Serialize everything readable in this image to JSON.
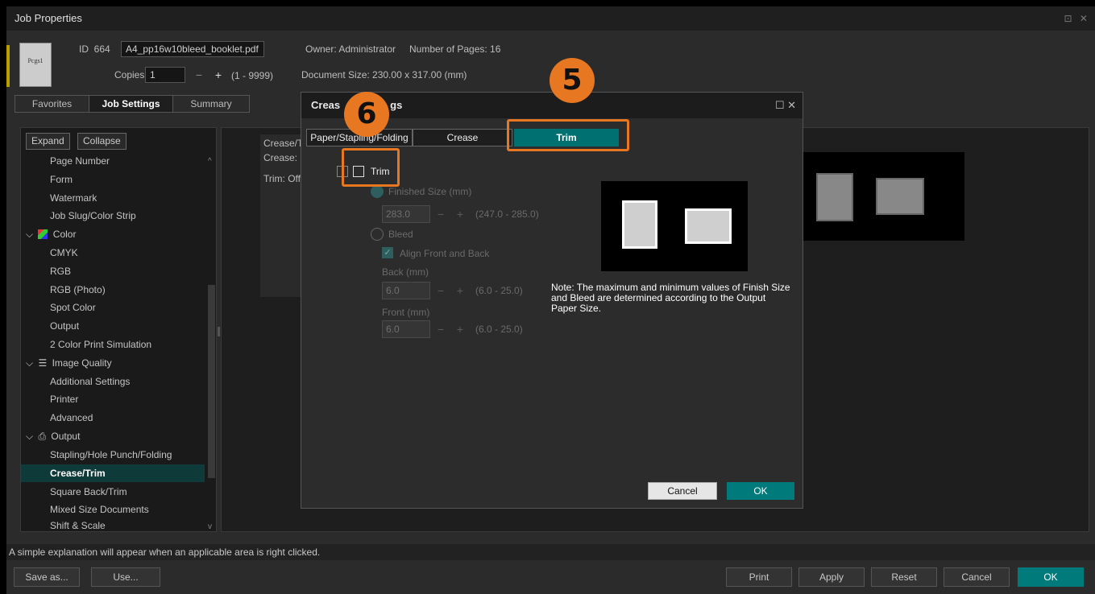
{
  "window": {
    "title": "Job Properties",
    "controls": "⊡ ✕"
  },
  "job": {
    "thumbnail_label": "Pcgs1",
    "id_label": "ID",
    "id_value": "664",
    "filename": "A4_pp16w10bleed_booklet.pdf",
    "copies_label": "Copies",
    "copies_value": "1",
    "copies_range": "(1 - 9999)",
    "owner": "Owner: Administrator",
    "pages": "Number of Pages: 16",
    "doc_size": "Document Size: 230.00 x 317.00 (mm)"
  },
  "main_tabs": [
    {
      "label": "Favorites"
    },
    {
      "label": "Job Settings"
    },
    {
      "label": "Summary"
    }
  ],
  "left_panel": {
    "expand": "Expand",
    "collapse": "Collapse",
    "items": [
      "Page Number",
      "Form",
      "Watermark",
      "Job Slug/Color Strip",
      "Color",
      "CMYK",
      "RGB",
      "RGB (Photo)",
      "Spot Color",
      "Output",
      "2 Color Print Simulation",
      "Image Quality",
      "Additional Settings",
      "Printer",
      "Advanced",
      "Output",
      "Stapling/Hole Punch/Folding",
      "Crease/Trim",
      "Square Back/Trim",
      "Mixed Size Documents",
      "Shift & Scale"
    ]
  },
  "summary_text": {
    "line1": "Crease/T",
    "line2": "Crease: C",
    "line3": "Trim: Off"
  },
  "status_text": "A simple explanation will appear when an applicable area is right clicked.",
  "bottom_buttons": {
    "save_as": "Save as...",
    "use": "Use...",
    "print": "Print",
    "apply": "Apply",
    "reset": "Reset",
    "cancel": "Cancel",
    "ok": "OK"
  },
  "modal": {
    "title_left": "Creas",
    "title_right": "gs",
    "controls": "☐ ✕",
    "tabs": [
      {
        "label": "Paper/Stapling/Folding"
      },
      {
        "label": "Crease"
      },
      {
        "label": "Trim"
      }
    ],
    "trim_checkbox_label": "Trim",
    "finished_size_label": "Finished Size (mm)",
    "finished_size_value": "283.0",
    "finished_size_range": "(247.0 - 285.0)",
    "bleed_label": "Bleed",
    "align_label": "Align Front and Back",
    "back_label": "Back (mm)",
    "back_value": "6.0",
    "back_range": "(6.0 - 25.0)",
    "front_label": "Front (mm)",
    "front_value": "6.0",
    "front_range": "(6.0 - 25.0)",
    "note": "Note: The maximum and minimum values of Finish Size and Bleed are determined according to the Output Paper Size.",
    "cancel": "Cancel",
    "ok": "OK"
  },
  "callouts": {
    "badge5": "5",
    "badge6": "6"
  },
  "colors": {
    "accent": "#007a7a",
    "callout": "#e87722"
  }
}
